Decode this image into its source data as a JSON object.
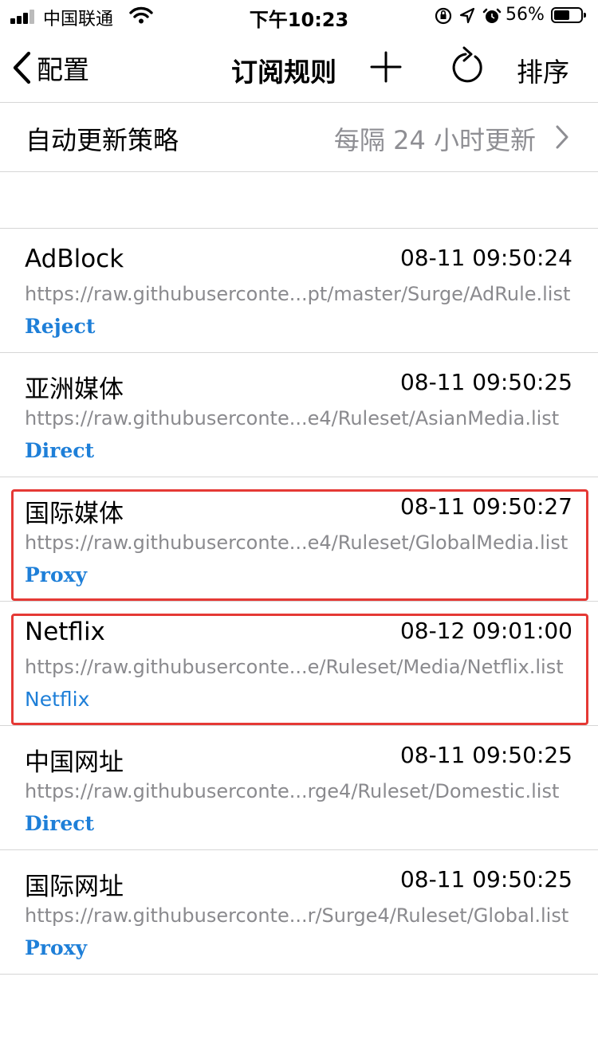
{
  "status_bar": {
    "carrier": "中国联通",
    "time": "下午10:23",
    "battery": "56%",
    "battery_level": 0.56
  },
  "nav": {
    "back_label": "配置",
    "title": "订阅规则",
    "sort_label": "排序"
  },
  "settings": {
    "update_label": "自动更新策略",
    "update_value": "每隔 24 小时更新"
  },
  "rules": [
    {
      "name": "AdBlock",
      "time": "08-11 09:50:24",
      "url": "https://raw.githubuserconte...pt/master/Surge/AdRule.list",
      "policy": "Reject",
      "highlighted": false
    },
    {
      "name": "亚洲媒体",
      "time": "08-11 09:50:25",
      "url": "https://raw.githubuserconte...e4/Ruleset/AsianMedia.list",
      "policy": "Direct",
      "highlighted": false
    },
    {
      "name": "国际媒体",
      "time": "08-11 09:50:27",
      "url": "https://raw.githubuserconte...e4/Ruleset/GlobalMedia.list",
      "policy": "Proxy",
      "highlighted": true
    },
    {
      "name": "Netflix",
      "time": "08-12 09:01:00",
      "url": "https://raw.githubuserconte...e/Ruleset/Media/Netflix.list",
      "policy": "Netflix",
      "highlighted": true
    },
    {
      "name": "中国网址",
      "time": "08-11 09:50:25",
      "url": "https://raw.githubuserconte...rge4/Ruleset/Domestic.list",
      "policy": "Direct",
      "highlighted": false
    },
    {
      "name": "国际网址",
      "time": "08-11 09:50:25",
      "url": "https://raw.githubuserconte...r/Surge4/Ruleset/Global.list",
      "policy": "Proxy",
      "highlighted": false
    }
  ],
  "colors": {
    "policy": "#1e7fd8",
    "highlight": "#e53935",
    "secondary_text": "#8e8e93"
  },
  "icons": [
    "signal-icon",
    "wifi-icon",
    "orientation-lock-icon",
    "location-icon",
    "alarm-icon",
    "battery-icon",
    "back-chevron-icon",
    "add-icon",
    "refresh-icon",
    "chevron-right-icon"
  ]
}
